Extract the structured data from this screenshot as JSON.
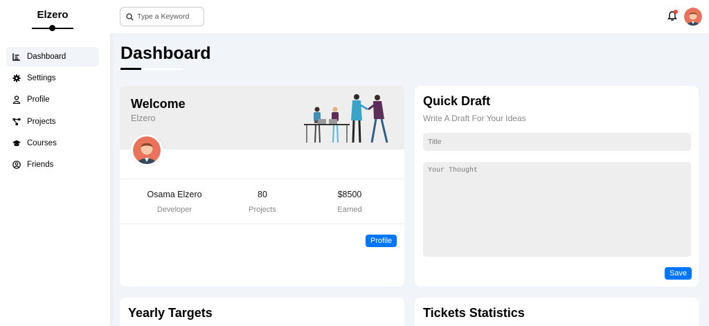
{
  "sidebar": {
    "brand": "Elzero",
    "items": [
      {
        "label": "Dashboard",
        "icon": "chart-icon",
        "active": true
      },
      {
        "label": "Settings",
        "icon": "gear-icon",
        "active": false
      },
      {
        "label": "Profile",
        "icon": "user-icon",
        "active": false
      },
      {
        "label": "Projects",
        "icon": "diagram-icon",
        "active": false
      },
      {
        "label": "Courses",
        "icon": "graduation-cap-icon",
        "active": false
      },
      {
        "label": "Friends",
        "icon": "user-circle-icon",
        "active": false
      }
    ]
  },
  "header": {
    "search_placeholder": "Type a Keyword",
    "notification_icon": "bell-icon",
    "notification_dot_color": "#f44336"
  },
  "main": {
    "page_title": "Dashboard",
    "welcome": {
      "title": "Welcome",
      "subtitle": "Elzero",
      "stats": [
        {
          "value": "Osama Elzero",
          "label": "Developer"
        },
        {
          "value": "80",
          "label": "Projects"
        },
        {
          "value": "$8500",
          "label": "Earned"
        }
      ],
      "profile_button": "Profile"
    },
    "quick_draft": {
      "title": "Quick Draft",
      "subtitle": "Write A Draft For Your Ideas",
      "title_placeholder": "Title",
      "body_placeholder": "Your Thought",
      "save_button": "Save"
    },
    "yearly_targets": {
      "title": "Yearly Targets"
    },
    "tickets_statistics": {
      "title": "Tickets Statistics"
    }
  },
  "colors": {
    "accent": "#0075ff",
    "background": "#f1f4f8",
    "card_head": "#eeeeee"
  }
}
